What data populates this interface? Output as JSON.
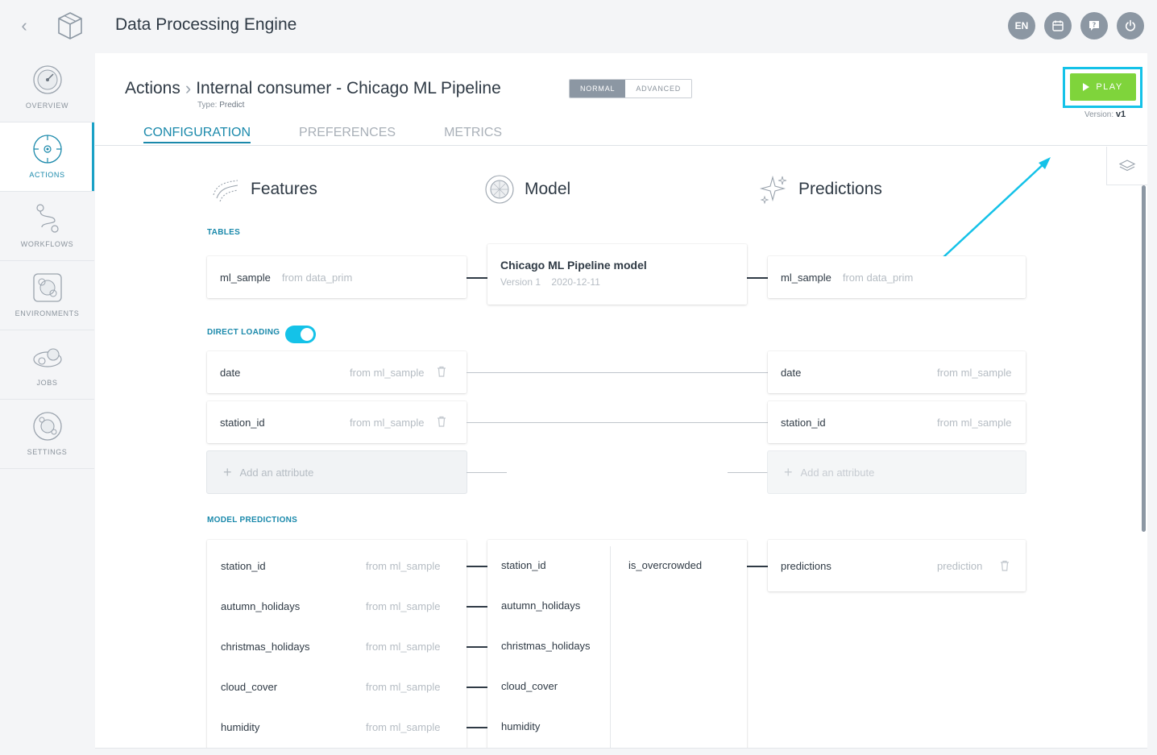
{
  "app": {
    "title": "Data Processing Engine"
  },
  "topbar": {
    "language": "EN"
  },
  "sidebar": {
    "items": [
      {
        "label": "OVERVIEW",
        "icon": "gauge-icon"
      },
      {
        "label": "ACTIONS",
        "icon": "target-icon",
        "active": true
      },
      {
        "label": "WORKFLOWS",
        "icon": "workflow-icon"
      },
      {
        "label": "ENVIRONMENTS",
        "icon": "environment-icon"
      },
      {
        "label": "JOBS",
        "icon": "gears-icon"
      },
      {
        "label": "SETTINGS",
        "icon": "cog-icon"
      }
    ]
  },
  "header": {
    "breadcrumb_root": "Actions",
    "breadcrumb_current": "Internal consumer - Chicago ML Pipeline",
    "type_prefix": "Type:",
    "type_value": "Predict",
    "mode_normal": "NORMAL",
    "mode_advanced": "ADVANCED",
    "play_label": "PLAY",
    "version_prefix": "Version:",
    "version_value": "v1"
  },
  "tabs": [
    {
      "label": "CONFIGURATION",
      "active": true
    },
    {
      "label": "PREFERENCES"
    },
    {
      "label": "METRICS"
    }
  ],
  "columns": {
    "features": "Features",
    "model": "Model",
    "predictions": "Predictions"
  },
  "tables": {
    "label": "TABLES",
    "input_table": "ml_sample",
    "input_source": "from data_prim",
    "model_name": "Chicago ML Pipeline model",
    "model_version": "Version 1",
    "model_date": "2020-12-11",
    "output_table": "ml_sample",
    "output_source": "from data_prim"
  },
  "direct_loading": {
    "label": "DIRECT LOADING",
    "enabled": true,
    "rows": [
      {
        "name": "date",
        "source": "from ml_sample",
        "out_name": "date",
        "out_source": "from ml_sample"
      },
      {
        "name": "station_id",
        "source": "from ml_sample",
        "out_name": "station_id",
        "out_source": "from ml_sample"
      }
    ],
    "add_label": "Add an attribute",
    "add_label_right": "Add an attribute"
  },
  "model_predictions": {
    "label": "MODEL PREDICTIONS",
    "features": [
      {
        "name": "station_id",
        "source": "from ml_sample"
      },
      {
        "name": "autumn_holidays",
        "source": "from ml_sample"
      },
      {
        "name": "christmas_holidays",
        "source": "from ml_sample"
      },
      {
        "name": "cloud_cover",
        "source": "from ml_sample"
      },
      {
        "name": "humidity",
        "source": "from ml_sample"
      }
    ],
    "model_inputs": [
      "station_id",
      "autumn_holidays",
      "christmas_holidays",
      "cloud_cover",
      "humidity"
    ],
    "model_output": "is_overcrowded",
    "prediction_name": "predictions",
    "prediction_source": "prediction"
  },
  "colors": {
    "accent": "#1a89ab",
    "play": "#7fd43b",
    "highlight": "#14c2e8"
  }
}
